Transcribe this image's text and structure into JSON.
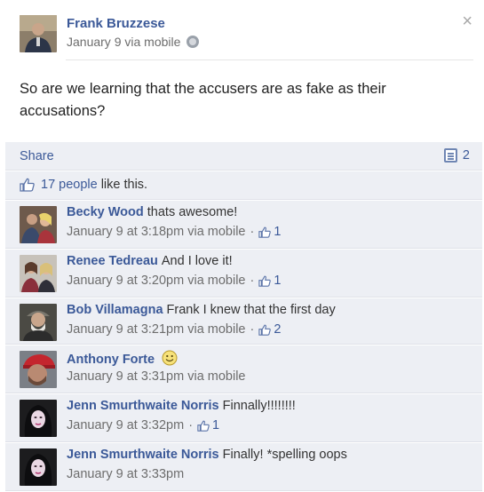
{
  "post": {
    "author": "Frank Bruzzese",
    "meta": "January 9 via mobile",
    "body": "So are we learning that the accusers are as fake as their accusations?",
    "close_glyph": "×"
  },
  "actions": {
    "share_label": "Share",
    "comment_count": "2"
  },
  "likes": {
    "count_label": "17 people",
    "suffix": "like this."
  },
  "comments": [
    {
      "author": "Becky Wood",
      "text": "thats awesome!",
      "meta": "January 9 at 3:18pm via mobile",
      "likes": "1"
    },
    {
      "author": "Renee Tedreau",
      "text": "And I love it!",
      "meta": "January 9 at 3:20pm via mobile",
      "likes": "1"
    },
    {
      "author": "Bob Villamagna",
      "text": "Frank I knew that the first day",
      "meta": "January 9 at 3:21pm via mobile",
      "likes": "2"
    },
    {
      "author": "Anthony Forte",
      "text": "",
      "meta": "January 9 at 3:31pm via mobile",
      "likes": ""
    },
    {
      "author": "Jenn Smurthwaite Norris",
      "text": "Finnally!!!!!!!!",
      "meta": "January 9 at 3:32pm",
      "likes": "1"
    },
    {
      "author": "Jenn Smurthwaite Norris",
      "text": "Finally! *spelling oops",
      "meta": "January 9 at 3:33pm",
      "likes": ""
    }
  ],
  "colors": {
    "link": "#3b5998",
    "panel": "#edeff4",
    "meta": "#6d6d6d"
  }
}
